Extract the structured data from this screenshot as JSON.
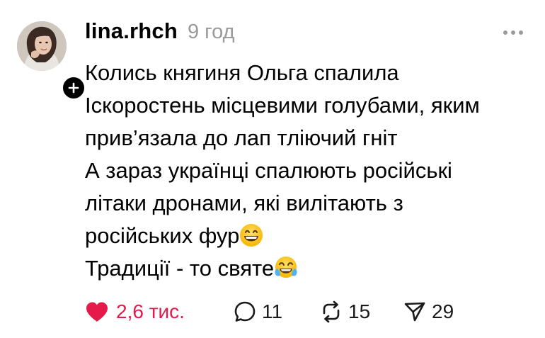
{
  "post": {
    "author": {
      "username": "lina.rhch",
      "avatar_icon": "user-avatar-photo",
      "follow_icon": "plus-icon"
    },
    "time_ago": "9 год",
    "more_icon": "ellipsis-icon",
    "text_lines": [
      "Колись княгиня Ольга спалила",
      "Іскоростень місцевими голубами, яким",
      "прив’язала до лап тліючий гніт",
      "А зараз українці спалюють російські",
      "літаки дронами, які вилітають з",
      "російських фур",
      "Традиції - то святе"
    ],
    "emojis": {
      "line6": "grinning-face-emoji",
      "line7": "tears-of-joy-emoji"
    },
    "actions": {
      "likes": {
        "icon": "heart-icon",
        "count": "2,6 тис.",
        "liked": true,
        "color": "#e5194a"
      },
      "replies": {
        "icon": "comment-icon",
        "count": "11"
      },
      "reposts": {
        "icon": "repost-icon",
        "count": "15"
      },
      "shares": {
        "icon": "send-icon",
        "count": "29"
      }
    }
  }
}
